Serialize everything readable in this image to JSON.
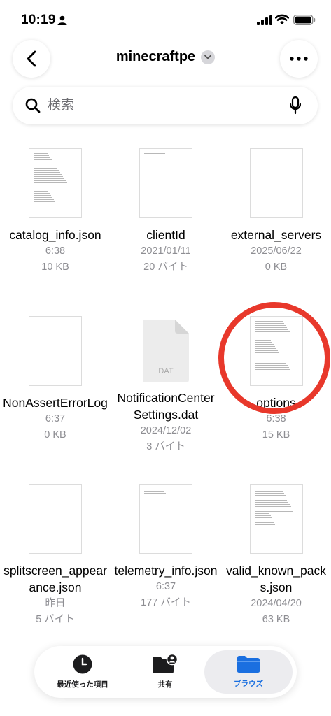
{
  "status_bar": {
    "time": "10:19"
  },
  "nav": {
    "title": "minecraftpe"
  },
  "search": {
    "placeholder": "検索"
  },
  "files": [
    {
      "name": "catalog_info.json",
      "date": "6:38",
      "size": "10 KB",
      "thumb": "text-long"
    },
    {
      "name": "clientId",
      "date": "2021/01/11",
      "size": "20 バイト",
      "thumb": "text-oneline"
    },
    {
      "name": "external_servers",
      "date": "2025/06/22",
      "size": "0 KB",
      "thumb": "blank"
    },
    {
      "name": "NonAssertErrorLog",
      "date": "6:37",
      "size": "0 KB",
      "thumb": "blank"
    },
    {
      "name": "NotificationCenterSettings.dat",
      "date": "2024/12/02",
      "size": "3 バイト",
      "thumb": "dat"
    },
    {
      "name": "options",
      "date": "6:38",
      "size": "15 KB",
      "thumb": "text-long"
    },
    {
      "name": "splitscreen_appearance.json",
      "date": "昨日",
      "size": "5 バイト",
      "thumb": "dot"
    },
    {
      "name": "telemetry_info.json",
      "date": "6:37",
      "size": "177 バイト",
      "thumb": "text-short"
    },
    {
      "name": "valid_known_packs.json",
      "date": "2024/04/20",
      "size": "63 KB",
      "thumb": "text-sparse"
    }
  ],
  "dat_badge": "DAT",
  "tabs": [
    {
      "label": "最近使った項目",
      "icon": "clock-icon",
      "active": false
    },
    {
      "label": "共有",
      "icon": "shared-folder-icon",
      "active": false
    },
    {
      "label": "ブラウズ",
      "icon": "folder-icon",
      "active": true
    }
  ],
  "colors": {
    "accent": "#1a6fe0",
    "annotation": "#e8382b",
    "meta_text": "#8e8e93"
  }
}
